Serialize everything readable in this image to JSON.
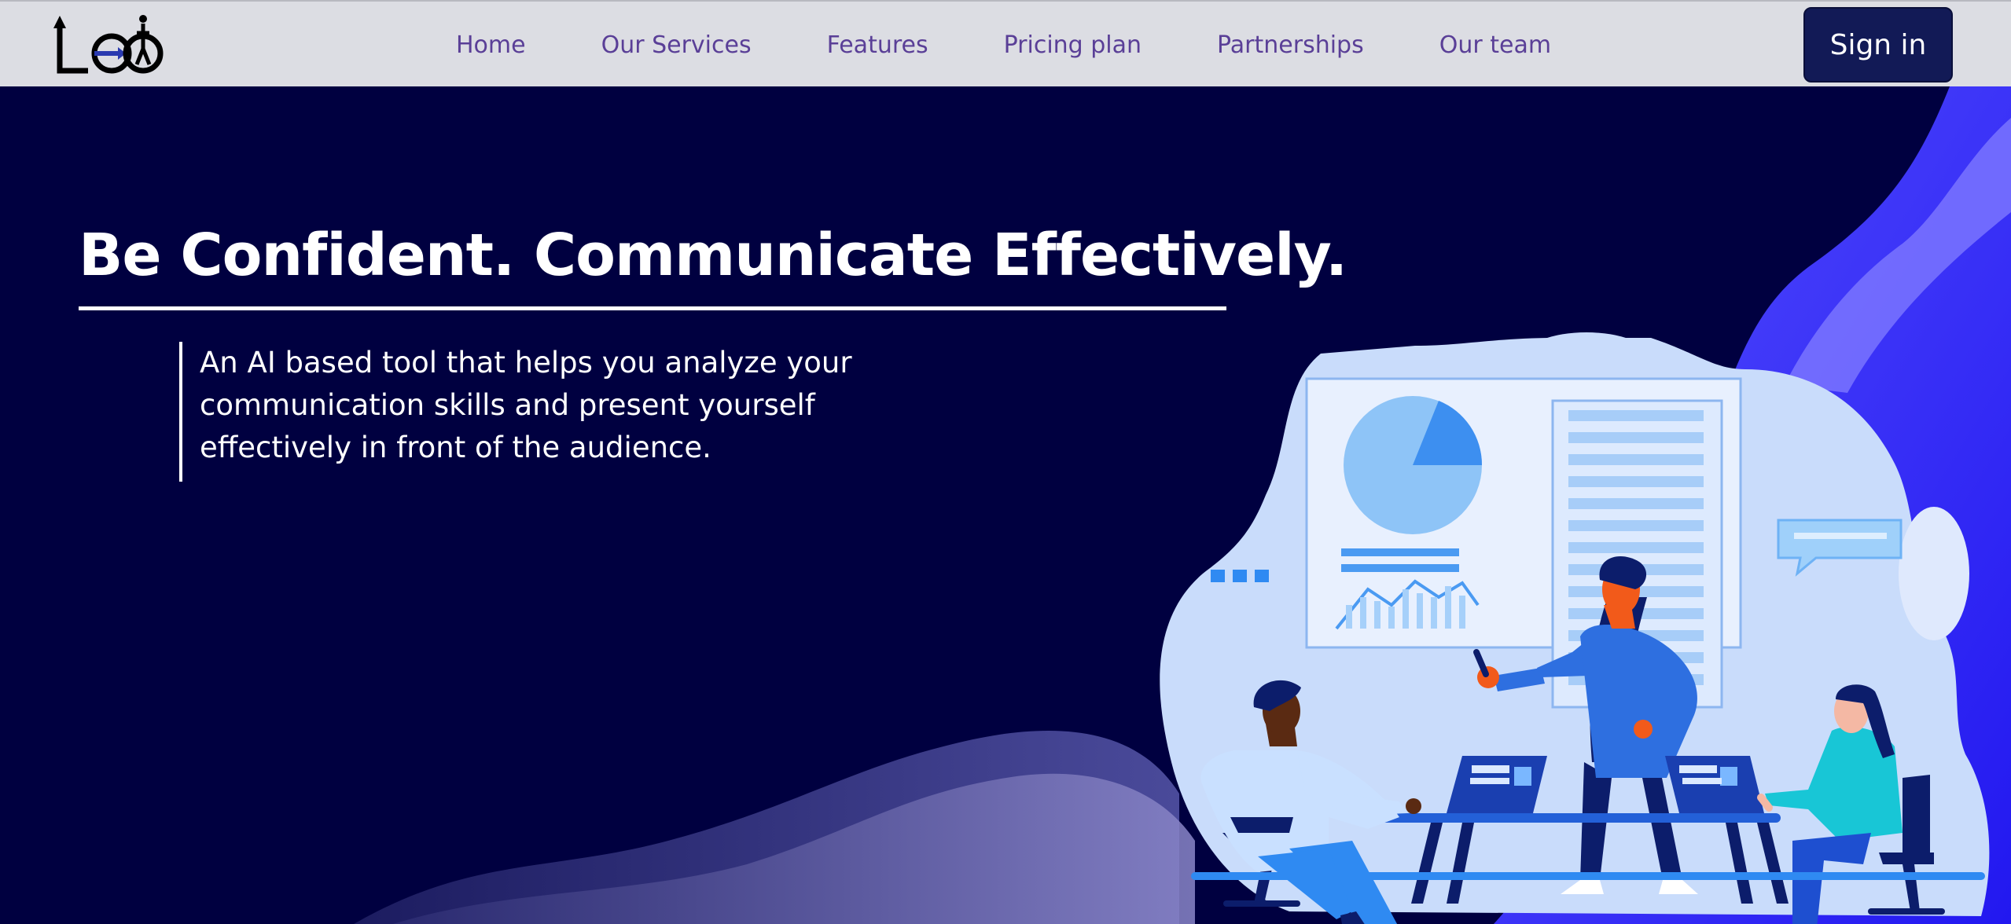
{
  "brand": {
    "logo_text": "LEO"
  },
  "nav": {
    "links": [
      "Home",
      "Our Services",
      "Features",
      "Pricing plan",
      "Partnerships",
      "Our team"
    ],
    "signin_label": "Sign in"
  },
  "hero": {
    "headline": "Be Confident. Communicate Effectively.",
    "subtext": "An AI based tool that helps you analyze your communication skills and present yourself effectively in front of the audience."
  },
  "colors": {
    "nav_bg": "#dcdde3",
    "nav_link": "#5a3f97",
    "signin_bg": "#121a56",
    "hero_bg": "#000040",
    "accent_blue": "#2a24f5",
    "illustration_blob": "#c9dcfb"
  },
  "icons": [
    "logo-icon",
    "pie-chart-icon",
    "bar-chart-icon",
    "speech-bubble-icon",
    "laptop-icon"
  ]
}
